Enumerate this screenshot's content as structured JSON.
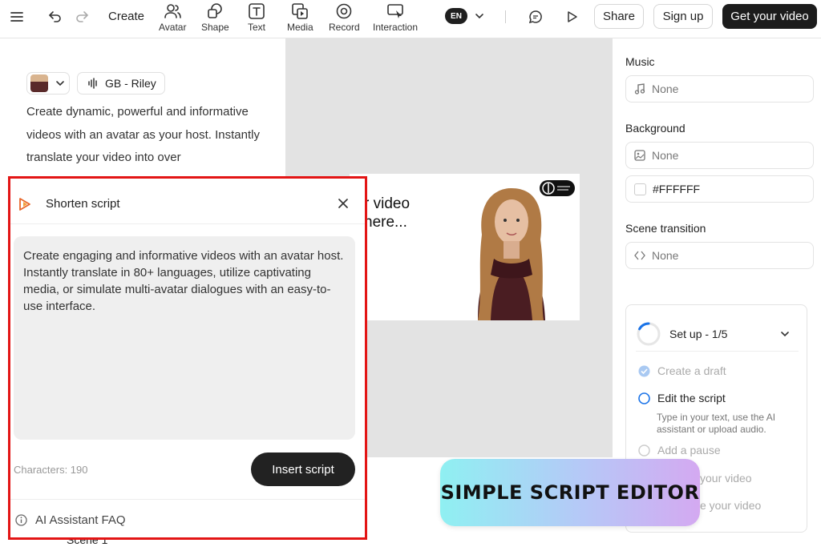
{
  "toolbar": {
    "create_label": "Create",
    "tools": [
      {
        "label": "Avatar",
        "icon": "avatar-icon"
      },
      {
        "label": "Shape",
        "icon": "shape-icon"
      },
      {
        "label": "Text",
        "icon": "text-icon"
      },
      {
        "label": "Media",
        "icon": "media-icon"
      },
      {
        "label": "Record",
        "icon": "record-icon"
      },
      {
        "label": "Interaction",
        "icon": "interaction-icon"
      }
    ],
    "language": "EN",
    "share_label": "Share",
    "signup_label": "Sign up",
    "get_video_label": "Get your video"
  },
  "left": {
    "voice_label": "GB - Riley",
    "intro_text": "Create dynamic, powerful and informative videos with an avatar as your host. Instantly translate your video into over"
  },
  "canvas": {
    "slide_text": "r video\nhere...",
    "scene_label": "Scene 1"
  },
  "popup": {
    "title": "Shorten script",
    "script_text": "Create engaging and informative videos with an avatar host. Instantly translate in 80+ languages, utilize captivating media, or simulate multi-avatar dialogues with an easy-to-use interface.",
    "characters": "Characters: 190",
    "insert_label": "Insert script",
    "faq_label": "AI Assistant FAQ"
  },
  "right": {
    "music_label": "Music",
    "music_value": "None",
    "background_label": "Background",
    "background_value": "None",
    "background_color": "#FFFFFF",
    "transition_label": "Scene transition",
    "transition_value": "None"
  },
  "setup": {
    "title": "Set up - 1/5",
    "steps": [
      {
        "label": "Create a draft",
        "state": "done"
      },
      {
        "label": "Edit the script",
        "state": "active"
      },
      {
        "label": "Add a pause",
        "state": "pending"
      },
      {
        "label": "your video",
        "state": "pending"
      },
      {
        "label": "e your video",
        "state": "pending"
      }
    ],
    "active_desc": "Type in your text, use the AI assistant or upload audio."
  },
  "banner": {
    "text": "SIMPLE SCRIPT EDITOR"
  },
  "colors": {
    "highlight_border": "#e31515",
    "dark_button": "#1c1c1c",
    "active_step": "#1a73e8"
  }
}
